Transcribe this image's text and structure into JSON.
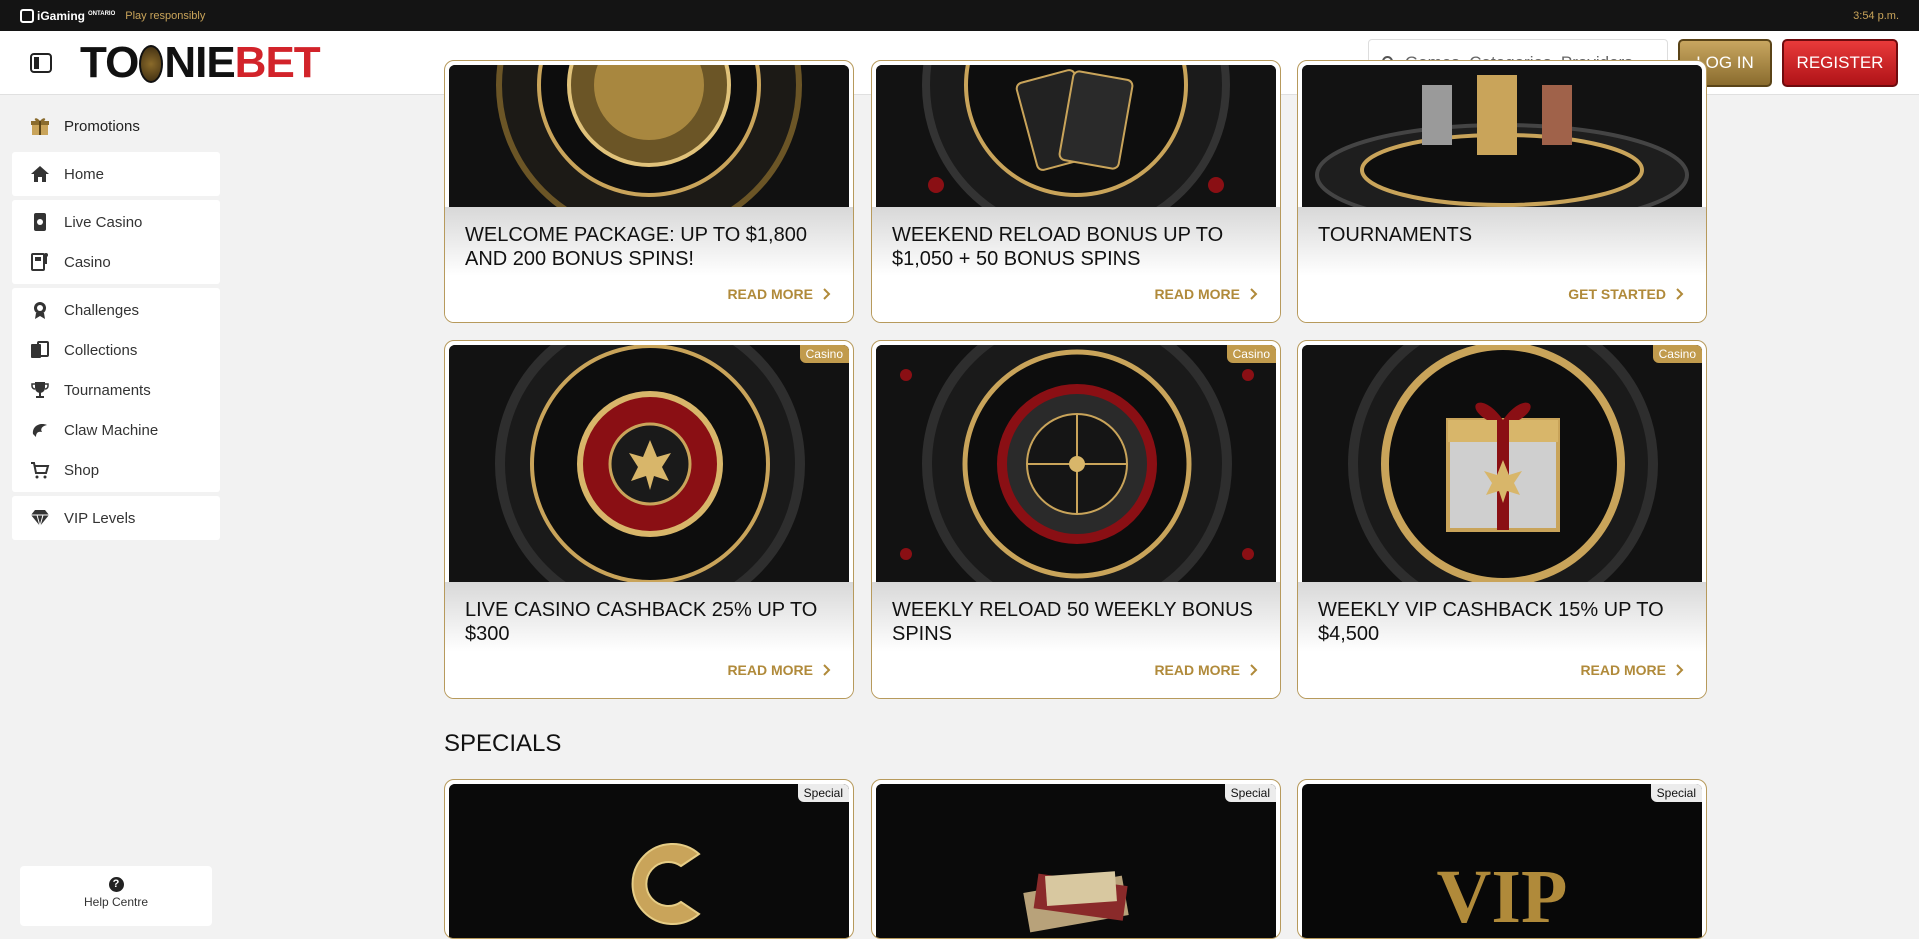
{
  "topbar": {
    "brand": "iGaming",
    "brand_sup": "ONTARIO",
    "play_responsibly": "Play responsibly",
    "clock": "3:54 p.m."
  },
  "header": {
    "logo_part1": "TO",
    "logo_part2": "NIE",
    "logo_part3": "BET",
    "search_placeholder": "Games, Categories, Providers",
    "login_label": "LOG IN",
    "register_label": "REGISTER"
  },
  "sidebar": {
    "promotions": "Promotions",
    "home": "Home",
    "live_casino": "Live Casino",
    "casino": "Casino",
    "challenges": "Challenges",
    "collections": "Collections",
    "tournaments": "Tournaments",
    "claw_machine": "Claw Machine",
    "shop": "Shop",
    "vip_levels": "VIP Levels"
  },
  "help": {
    "label": "Help Centre"
  },
  "promos_row1": [
    {
      "title": "WELCOME PACKAGE: UP TO $1,800 AND 200 BONUS SPINS!",
      "cta": "READ MORE"
    },
    {
      "title": "WEEKEND RELOAD BONUS UP TO $1,050 + 50 BONUS SPINS",
      "cta": "READ MORE"
    },
    {
      "title": "TOURNAMENTS",
      "cta": "GET STARTED"
    }
  ],
  "promos_row2": [
    {
      "badge": "Casino",
      "title": "LIVE CASINO CASHBACK 25% UP TO $300",
      "cta": "READ MORE"
    },
    {
      "badge": "Casino",
      "title": "WEEKLY RELOAD 50 WEEKLY BONUS SPINS",
      "cta": "READ MORE"
    },
    {
      "badge": "Casino",
      "title": "WEEKLY VIP CASHBACK 15% UP TO $4,500",
      "cta": "READ MORE"
    }
  ],
  "specials": {
    "heading": "SPECIALS",
    "cards": [
      {
        "badge": "Special"
      },
      {
        "badge": "Special"
      },
      {
        "badge": "Special",
        "image_text": "VIP"
      }
    ]
  },
  "colors": {
    "gold": "#b08a3a",
    "red": "#d2232a",
    "dark": "#141414"
  }
}
